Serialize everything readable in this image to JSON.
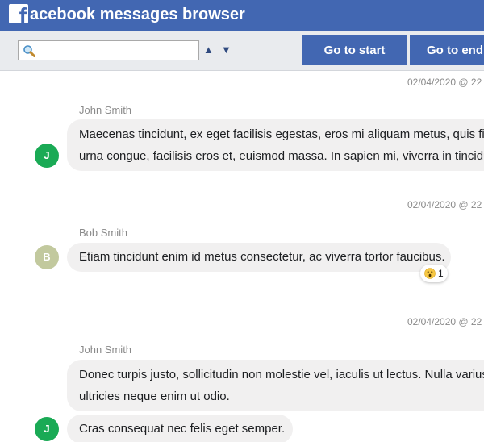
{
  "app": {
    "logo_letter": "f",
    "title": "acebook messages browser"
  },
  "toolbar": {
    "search_value": "",
    "prev_arrow": "▲",
    "next_arrow": "▼",
    "start_label": "Go to start",
    "end_label": "Go to end"
  },
  "messages": [
    {
      "timestamp": "02/04/2020 @ 22",
      "sender": "John Smith",
      "avatar_letter": "J",
      "avatar_color": "#1aaa55",
      "bubbles": [
        [
          "Maecenas tincidunt, ex eget facilisis egestas, eros mi aliquam metus, quis finibus",
          "urna congue, facilisis eros et, euismod massa. In sapien mi, viverra in tincidunt"
        ]
      ]
    },
    {
      "timestamp": "02/04/2020 @ 22",
      "sender": "Bob Smith",
      "avatar_letter": "B",
      "avatar_color": "#c2c99e",
      "bubbles": [
        [
          "Etiam tincidunt enim id metus consectetur, ac viverra tortor faucibus."
        ]
      ],
      "reaction": {
        "emoji": "astonished-face-icon",
        "count": "1"
      }
    },
    {
      "timestamp": "02/04/2020 @ 22",
      "sender": "John Smith",
      "avatar_letter": "J",
      "avatar_color": "#1aaa55",
      "bubbles": [
        [
          "Donec turpis justo, sollicitudin non molestie vel, iaculis ut lectus. Nulla varius, lorem",
          "ultricies neque enim ut odio."
        ],
        [
          "Cras consequat nec felis eget semper."
        ]
      ]
    }
  ],
  "colors": {
    "brand": "#4267b2",
    "toolbar_bg": "#e9ebee",
    "bubble_bg": "#f1f0f0",
    "meta_text": "#8a8a8a"
  }
}
